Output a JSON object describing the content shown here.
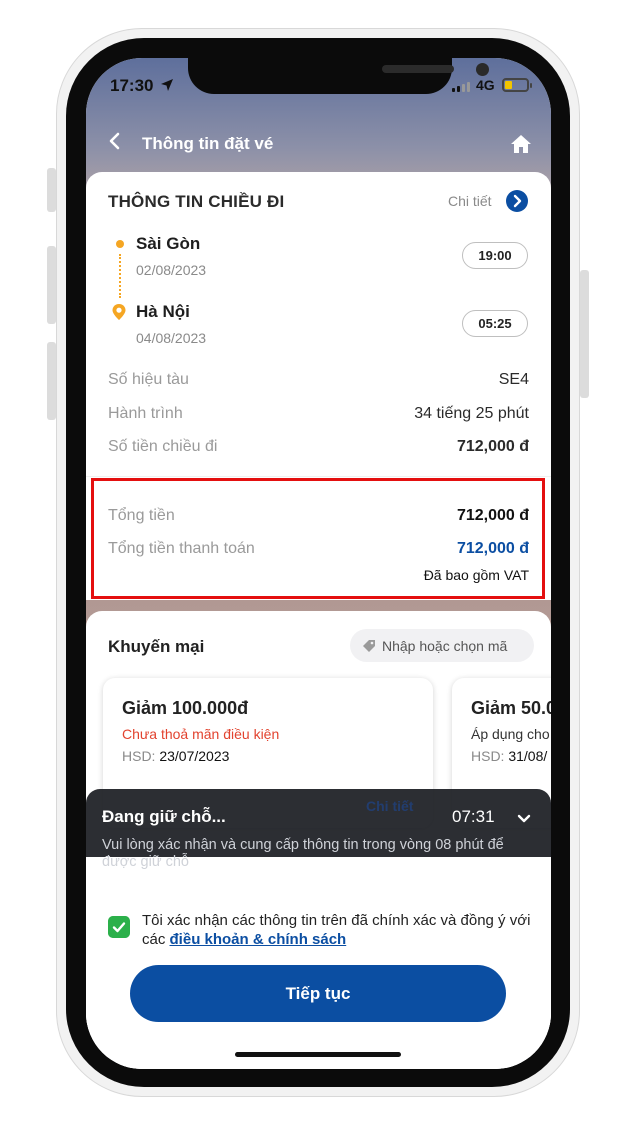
{
  "status_bar": {
    "time": "17:30",
    "network": "4G"
  },
  "header": {
    "title": "Thông tin đặt vé"
  },
  "trip": {
    "section_title": "THÔNG TIN CHIỀU ĐI",
    "detail_label": "Chi tiết",
    "departure": {
      "city": "Sài Gòn",
      "date": "02/08/2023",
      "time": "19:00"
    },
    "arrival": {
      "city": "Hà Nội",
      "date": "04/08/2023",
      "time": "05:25"
    },
    "rows": [
      {
        "label": "Số hiệu tàu",
        "value": "SE4"
      },
      {
        "label": "Hành trình",
        "value": "34 tiếng 25 phút"
      },
      {
        "label": "Số tiền chiều đi",
        "value": "712,000 đ"
      }
    ]
  },
  "totals": {
    "total_label": "Tổng tiền",
    "total_value": "712,000 đ",
    "payment_label": "Tổng tiền thanh toán",
    "payment_value": "712,000 đ",
    "vat_note": "Đã bao gồm VAT"
  },
  "promo": {
    "title": "Khuyến mại",
    "code_placeholder": "Nhập hoặc chọn mã",
    "vouchers": [
      {
        "title": "Giảm 100.000đ",
        "condition": "Chưa thoả mãn điều kiện",
        "expiry_label": "HSD:",
        "expiry": "23/07/2023",
        "detail": "Chi tiết"
      },
      {
        "title": "Giảm 50.0",
        "condition": "Áp dụng cho",
        "expiry_label": "HSD:",
        "expiry": "31/08/"
      }
    ]
  },
  "hold": {
    "title": "Đang giữ chỗ...",
    "timer": "07:31",
    "description": "Vui lòng xác nhận và cung cấp thông tin trong vòng 08 phút để được giữ chỗ"
  },
  "confirm": {
    "text": "Tôi xác nhận các thông tin trên đã chính xác và đồng ý với các",
    "link": "điều khoản & chính sách",
    "checked": true
  },
  "continue_button": {
    "label": "Tiếp tục"
  },
  "colors": {
    "primary": "#0b4ea2",
    "accent": "#f5a623",
    "success": "#2bb04a",
    "highlight": "#e40f0f",
    "warning_text": "#e2432f"
  }
}
